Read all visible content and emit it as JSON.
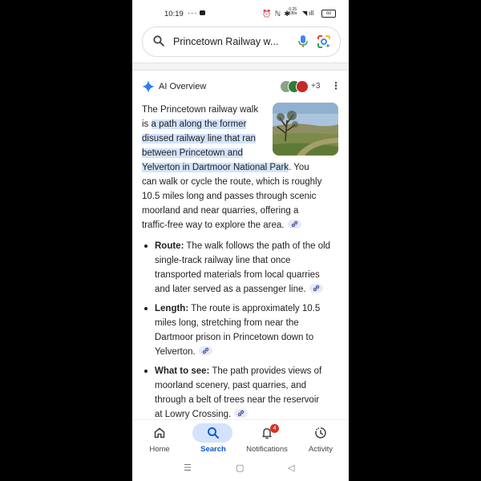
{
  "status_bar": {
    "time": "10:19",
    "dots": "···",
    "system_icons": "⏰ ℕ ✱",
    "net_speed_value": "0.25",
    "net_speed_unit": "KB/s",
    "wifi_signal": "◥ ıll",
    "battery": "60"
  },
  "search": {
    "query": "Princetown Railway w..."
  },
  "ai_overview": {
    "title": "AI Overview",
    "more_sources": "+3",
    "paragraph_lines": [
      {
        "pre": "The Princetown railway walk",
        "hl": "",
        "post": ""
      },
      {
        "pre": "is ",
        "hl": "a path along the former",
        "post": ""
      },
      {
        "pre": "",
        "hl": "disused railway line that ran",
        "post": ""
      },
      {
        "pre": "",
        "hl": "between Princetown and",
        "post": ""
      },
      {
        "pre": "",
        "hl": "Yelverton in Dartmoor National Park",
        "post": ". You"
      },
      {
        "pre": "can walk or cycle the route, which is roughly",
        "hl": "",
        "post": ""
      },
      {
        "pre": "10.5 miles long and passes through scenic",
        "hl": "",
        "post": ""
      },
      {
        "pre": "moorland and near quarries, offering a",
        "hl": "",
        "post": ""
      },
      {
        "pre": "traffic-free way to explore the area.",
        "hl": "",
        "post": ""
      }
    ],
    "bullets": [
      {
        "label": "Route:",
        "lines": [
          " The walk follows the path of the old",
          "single-track railway line that once",
          "transported materials from local quarries",
          "and later served as a passenger line."
        ]
      },
      {
        "label": "Length:",
        "lines": [
          " The route is approximately 10.5",
          "miles long, stretching from near the",
          "Dartmoor prison in Princetown down to",
          "Yelverton."
        ]
      },
      {
        "label": "What to see:",
        "lines": [
          " The path provides views of",
          "moorland scenery, past quarries, and",
          "through a belt of trees near the reservoir",
          "at Lowry Crossing."
        ]
      }
    ]
  },
  "bottom_nav": {
    "items": [
      {
        "label": "Home",
        "icon": "home-icon"
      },
      {
        "label": "Search",
        "icon": "search-icon"
      },
      {
        "label": "Notifications",
        "icon": "bell-icon",
        "badge": "4"
      },
      {
        "label": "Activity",
        "icon": "activity-icon"
      }
    ]
  },
  "system_nav": {
    "menu": "☰",
    "home": "▢",
    "back": "◁"
  },
  "colors": {
    "accent": "#0b57d0",
    "highlight": "#d3e3fd",
    "badge": "#d93025"
  }
}
